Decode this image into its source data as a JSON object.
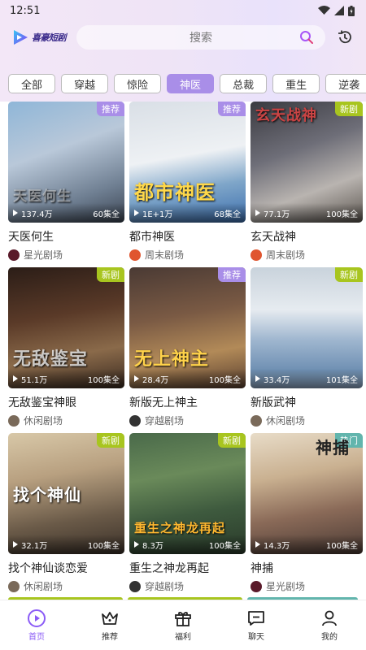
{
  "status": {
    "time": "12:51"
  },
  "header": {
    "logo_text": "喜豪短剧",
    "search_placeholder": "搜索"
  },
  "tabs": [
    {
      "label": "全部"
    },
    {
      "label": "穿越"
    },
    {
      "label": "惊险"
    },
    {
      "label": "神医"
    },
    {
      "label": "总裁"
    },
    {
      "label": "重生"
    },
    {
      "label": "逆袭"
    }
  ],
  "cards": [
    {
      "title": "天医何生",
      "channel": "星光剧场",
      "tag": "推荐",
      "views": "137.4万",
      "episodes": "60集全",
      "overlay": "天医何生"
    },
    {
      "title": "都市神医",
      "channel": "周末剧场",
      "tag": "推荐",
      "views": "1E+1万",
      "episodes": "68集全",
      "overlay": "都市神医"
    },
    {
      "title": "玄天战神",
      "channel": "周末剧场",
      "tag": "新剧",
      "views": "77.1万",
      "episodes": "100集全",
      "overlay": "玄天战神"
    },
    {
      "title": "无敌鉴宝神眼",
      "channel": "休闲剧场",
      "tag": "新剧",
      "views": "51.1万",
      "episodes": "100集全",
      "overlay": "无敌鉴宝"
    },
    {
      "title": "新版无上神主",
      "channel": "穿越剧场",
      "tag": "推荐",
      "views": "28.4万",
      "episodes": "100集全",
      "overlay": "无上神主"
    },
    {
      "title": "新版武神",
      "channel": "休闲剧场",
      "tag": "新剧",
      "views": "33.4万",
      "episodes": "101集全",
      "overlay": ""
    },
    {
      "title": "找个神仙谈恋爱",
      "channel": "休闲剧场",
      "tag": "新剧",
      "views": "32.1万",
      "episodes": "100集全",
      "overlay": "找个神仙"
    },
    {
      "title": "重生之神龙再起",
      "channel": "穿越剧场",
      "tag": "新剧",
      "views": "8.3万",
      "episodes": "100集全",
      "overlay": "重生之神龙再起"
    },
    {
      "title": "神捕",
      "channel": "星光剧场",
      "tag": "热门",
      "views": "14.3万",
      "episodes": "100集全",
      "overlay": "神捕"
    }
  ],
  "nav": [
    {
      "label": "首页"
    },
    {
      "label": "推荐"
    },
    {
      "label": "福利"
    },
    {
      "label": "聊天"
    },
    {
      "label": "我的"
    }
  ],
  "colors": {
    "accent": "#8b5cf6",
    "tag_new": "#a8c51f",
    "tag_rec": "#a98ee8",
    "tag_hot": "#62b5ad"
  }
}
